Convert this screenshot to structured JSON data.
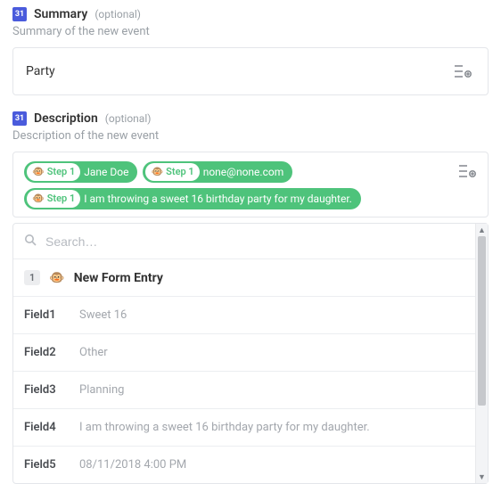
{
  "summary": {
    "icon_text": "31",
    "label": "Summary",
    "optional": "(optional)",
    "help": "Summary of the new event",
    "value": "Party"
  },
  "description": {
    "icon_text": "31",
    "label": "Description",
    "optional": "(optional)",
    "help": "Description of the new event",
    "tags": [
      {
        "step": "Step 1",
        "text": "Jane Doe"
      },
      {
        "step": "Step 1",
        "text": "none@none.com"
      },
      {
        "step": "Step 1",
        "text": "I am throwing a sweet 16 birthday party for my daughter."
      }
    ]
  },
  "picker": {
    "search_placeholder": "Search…",
    "header_badge": "1",
    "header_title": "New Form Entry",
    "fields": [
      {
        "name": "Field1",
        "value": "Sweet 16"
      },
      {
        "name": "Field2",
        "value": "Other"
      },
      {
        "name": "Field3",
        "value": "Planning"
      },
      {
        "name": "Field4",
        "value": "I am throwing a sweet 16 birthday party for my daughter."
      },
      {
        "name": "Field5",
        "value": "08/11/2018 4:00 PM"
      }
    ]
  }
}
